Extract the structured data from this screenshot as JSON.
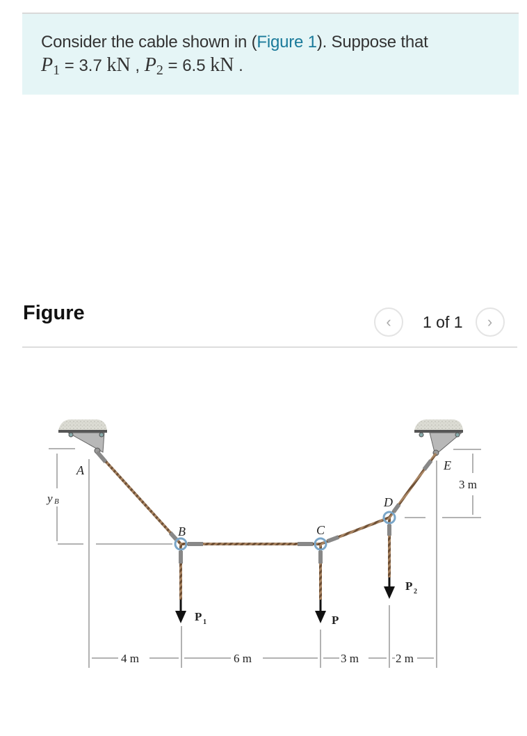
{
  "problem": {
    "intro": "Consider the cable shown in (",
    "link": "Figure 1",
    "outro": "). Suppose that",
    "p1_var": "P",
    "p1_sub": "1",
    "p1_eq": " = 3.7 ",
    "p1_unit": "kN",
    "sep": " , ",
    "p2_var": "P",
    "p2_sub": "2",
    "p2_eq": " = 6.5 ",
    "p2_unit": "kN",
    "end": " ."
  },
  "figure_section": {
    "title": "Figure",
    "prev_icon": "chevron-left-icon",
    "next_icon": "chevron-right-icon",
    "prev_glyph": "‹",
    "next_glyph": "›",
    "page_indicator": "1 of 1"
  },
  "diagram": {
    "labels": {
      "A": "A",
      "B": "B",
      "C": "C",
      "D": "D",
      "E": "E",
      "yB": "y",
      "yB_sub": "B",
      "P1": "P",
      "P1_sub": "1",
      "P": "P",
      "P2": "P",
      "P2_sub": "2",
      "dim_E": "3 m",
      "dim_1": "4 m",
      "dim_2": "6 m",
      "dim_3": "3 m",
      "dim_4": "2 m"
    },
    "colors": {
      "cable": "#8a6a4a",
      "ring": "#7aa6c8",
      "support": "#b0b0b0",
      "dim_line": "#999999"
    }
  }
}
